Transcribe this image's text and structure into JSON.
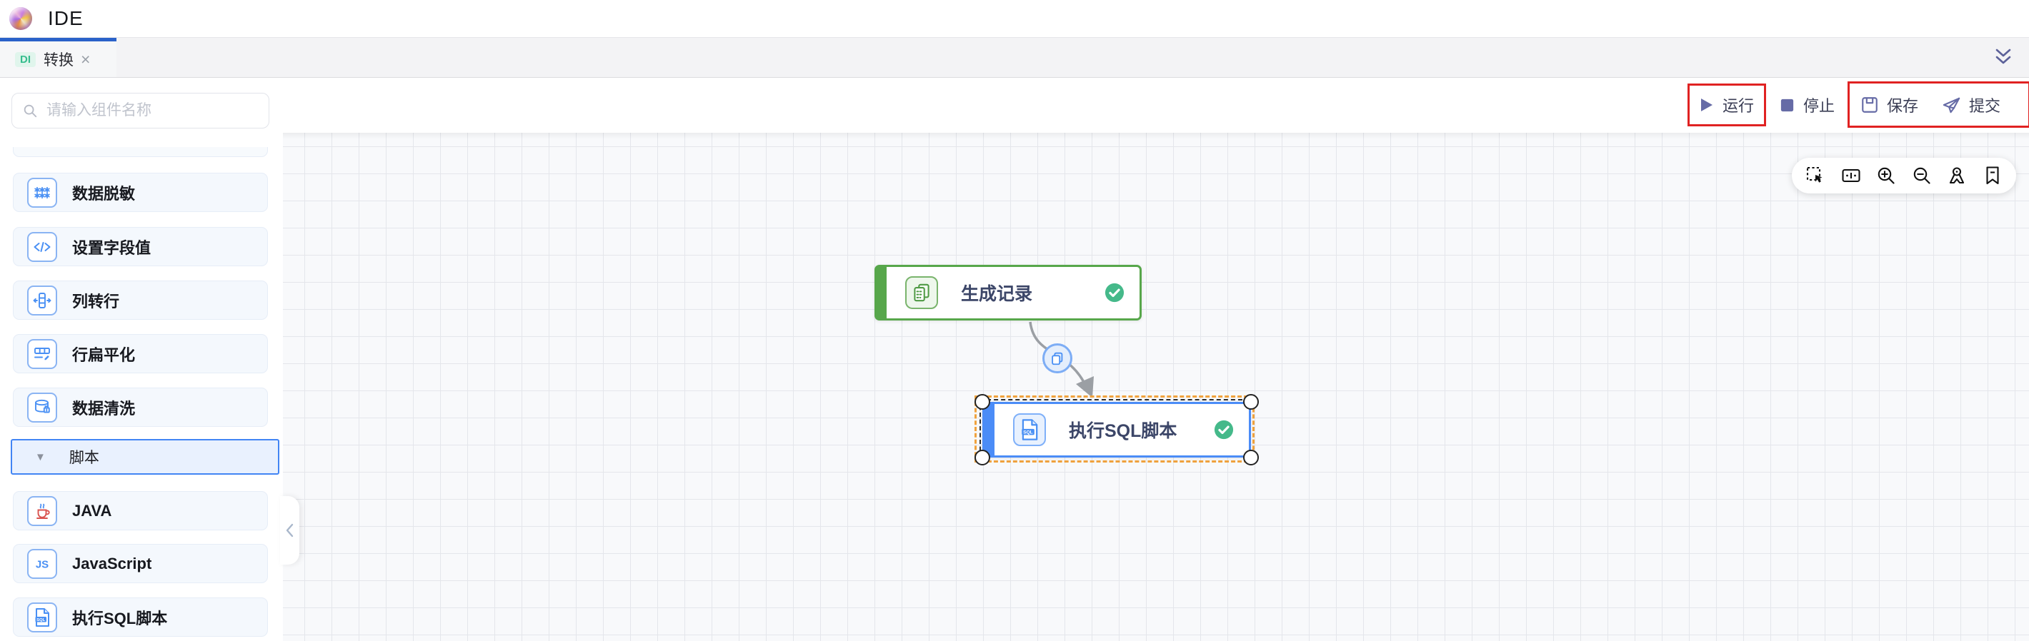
{
  "header": {
    "app_title": "IDE"
  },
  "tab_bar": {
    "active_tab": {
      "badge": "DI",
      "label": "转换",
      "close_glyph": "×"
    },
    "collapse_icon": "double-chevron-down"
  },
  "toolbar": {
    "run_label": "运行",
    "stop_label": "停止",
    "save_label": "保存",
    "submit_label": "提交",
    "icons": [
      "play-icon",
      "stop-square-icon",
      "save-floppy-icon",
      "submit-plane-icon"
    ],
    "annotations": [
      "red box around run button",
      "red box around save and submit buttons"
    ]
  },
  "sidebar": {
    "search": {
      "placeholder": "请输入组件名称",
      "value": "",
      "icon": "search-icon"
    },
    "items": [
      {
        "label": "数据脱敏",
        "icon": "data-mask-icon"
      },
      {
        "label": "设置字段值",
        "icon": "set-field-value-icon"
      },
      {
        "label": "列转行",
        "icon": "column-to-row-icon"
      },
      {
        "label": "行扁平化",
        "icon": "row-flatten-icon"
      },
      {
        "label": "数据清洗",
        "icon": "data-clean-icon"
      },
      {
        "label": "JAVA",
        "icon": "java-cup-icon"
      },
      {
        "label": "JavaScript",
        "icon": "js-icon"
      },
      {
        "label": "执行SQL脚本",
        "icon": "sql-file-icon"
      }
    ],
    "section": {
      "label": "脚本",
      "expanded": true,
      "triangle_glyph": "▼"
    },
    "collapse_handle_glyph": "‹"
  },
  "canvas": {
    "nodes": [
      {
        "label": "生成记录",
        "status": "success",
        "accent": "#57a74b",
        "icon": "copy-records-icon",
        "selected": false
      },
      {
        "label": "执行SQL脚本",
        "status": "success",
        "accent": "#4b8cf7",
        "icon": "sql-file-icon",
        "selected": true
      }
    ],
    "edge": {
      "from": "生成记录",
      "to": "执行SQL脚本",
      "badge_icon": "copy-icon"
    },
    "tools": [
      "marquee-select",
      "actual-size",
      "zoom-in",
      "zoom-out",
      "locate",
      "bookmark"
    ]
  },
  "colors": {
    "accent_blue": "#4b8cf7",
    "node_green": "#57a74b",
    "check_green": "#45b98a",
    "selection_orange": "#f0a23d",
    "annotation_red": "#e02222",
    "tab_indicator_blue": "#2a62c9",
    "di_badge_green": "#36bd8d",
    "action_icon_slate": "#5f649c"
  }
}
